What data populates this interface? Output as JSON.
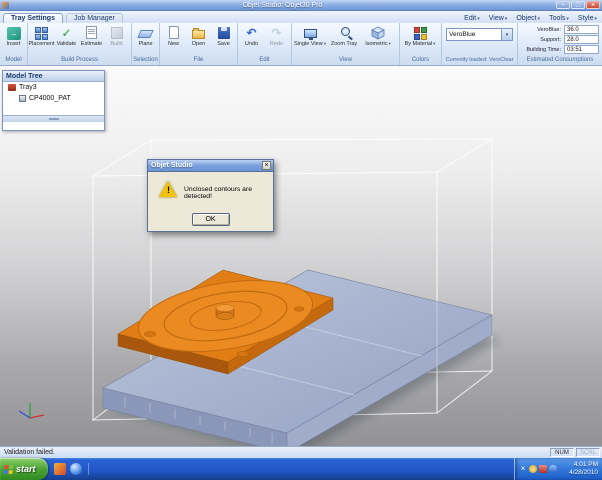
{
  "window": {
    "title": "Objet Studio: Objet30 Pro"
  },
  "icons": {
    "minimize": "−",
    "maximize": "□",
    "close": "×",
    "caret": "▾",
    "validate": "✓",
    "undo": "↶",
    "redo": "↷",
    "insert_arrow": "→",
    "warning": "!"
  },
  "tabs": {
    "tray_settings": "Tray Settings",
    "job_manager": "Job Manager"
  },
  "menubar": {
    "items": [
      "Edit",
      "View",
      "Object",
      "Tools",
      "Style"
    ]
  },
  "ribbon": {
    "model": {
      "label": "Model",
      "insert": "Insert"
    },
    "build_process": {
      "label": "Build Process",
      "placement": "Placement",
      "validate": "Validate",
      "estimate": "Estimate",
      "build": "Build"
    },
    "selection": {
      "label": "Selection",
      "plane": "Plane"
    },
    "file": {
      "label": "File",
      "new": "New",
      "open": "Open",
      "save": "Save"
    },
    "edit": {
      "label": "Edit",
      "undo": "Undo",
      "redo": "Redo"
    },
    "view": {
      "label": "View",
      "single_view": "Single View",
      "zoom_tray": "Zoom Tray",
      "isometric": "Isometric"
    },
    "colors": {
      "label": "Colors",
      "by_material": "By Material"
    },
    "material": {
      "label": "Currently loaded: VeroClear",
      "selected": "VeroBlue"
    },
    "consumptions": {
      "label": "Estimated Consumptions",
      "rows": [
        {
          "name": "VeroBlue:",
          "value": "36.0"
        },
        {
          "name": "Support:",
          "value": "28.0"
        },
        {
          "name": "Building Time:",
          "value": "03:51"
        }
      ]
    }
  },
  "model_tree": {
    "title": "Model Tree",
    "root": "Tray3",
    "child": "CP4000_PAT"
  },
  "dialog": {
    "title": "Objet Studio",
    "message": "Unclosed contours are detected!",
    "ok": "OK"
  },
  "statusbar": {
    "message": "Validation failed.",
    "num": "NUM",
    "scrl": "SCRL"
  },
  "taskbar": {
    "start": "start",
    "time": "4:01 PM",
    "date": "4/28/2010"
  }
}
